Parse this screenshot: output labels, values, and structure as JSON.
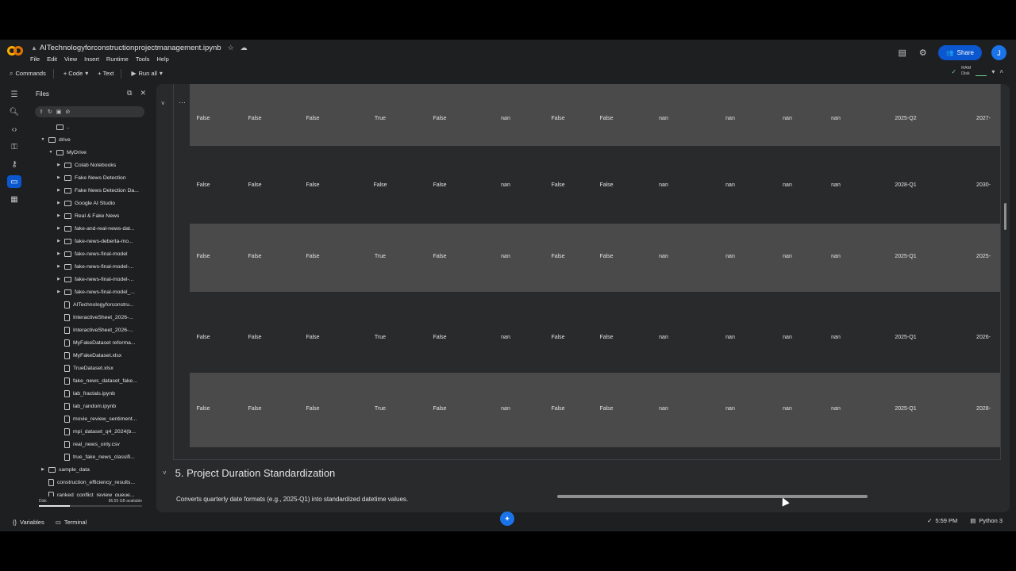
{
  "app": {
    "notebook_title": "AITechnologyforconstructionprojectmanagement.ipynb",
    "menus": [
      "File",
      "Edit",
      "View",
      "Insert",
      "Runtime",
      "Tools",
      "Help"
    ],
    "share_label": "Share",
    "avatar_initial": "J",
    "accent_color": "#0b57d0"
  },
  "toolbar": {
    "commands": "Commands",
    "code": "+ Code",
    "text": "+ Text",
    "run_all": "Run all",
    "ram_label": "RAM",
    "disk_label": "Disk"
  },
  "files_panel": {
    "title": "Files",
    "tree": [
      {
        "label": "..",
        "type": "folder",
        "level": 1,
        "caret": ""
      },
      {
        "label": "drive",
        "type": "folder",
        "level": 0,
        "caret": "▼"
      },
      {
        "label": "MyDrive",
        "type": "folder",
        "level": 1,
        "caret": "▼"
      },
      {
        "label": "Colab Notebooks",
        "type": "folder",
        "level": 2,
        "caret": "▶"
      },
      {
        "label": "Fake News Detection",
        "type": "folder",
        "level": 2,
        "caret": "▶"
      },
      {
        "label": "Fake News Detection Da...",
        "type": "folder",
        "level": 2,
        "caret": "▶"
      },
      {
        "label": "Google AI Studio",
        "type": "folder",
        "level": 2,
        "caret": "▶"
      },
      {
        "label": "Real & Fake News",
        "type": "folder",
        "level": 2,
        "caret": "▶"
      },
      {
        "label": "fake-and-real-news-dat...",
        "type": "folder",
        "level": 2,
        "caret": "▶"
      },
      {
        "label": "fake-news-deberta-mo...",
        "type": "folder",
        "level": 2,
        "caret": "▶"
      },
      {
        "label": "fake-news-final-model",
        "type": "folder",
        "level": 2,
        "caret": "▶"
      },
      {
        "label": "fake-news-final-model-...",
        "type": "folder",
        "level": 2,
        "caret": "▶"
      },
      {
        "label": "fake-news-final-model-...",
        "type": "folder",
        "level": 2,
        "caret": "▶"
      },
      {
        "label": "fake-news-final-model_...",
        "type": "folder",
        "level": 2,
        "caret": "▶"
      },
      {
        "label": "AITechnologyforconstru...",
        "type": "file",
        "level": 2,
        "caret": ""
      },
      {
        "label": "InteractiveSheet_2026-...",
        "type": "file",
        "level": 2,
        "caret": ""
      },
      {
        "label": "InteractiveSheet_2026-...",
        "type": "file",
        "level": 2,
        "caret": ""
      },
      {
        "label": "MyFakeDataset reforma...",
        "type": "file",
        "level": 2,
        "caret": ""
      },
      {
        "label": "MyFakeDataset.xlsx",
        "type": "file",
        "level": 2,
        "caret": ""
      },
      {
        "label": "TrueDataset.xlsx",
        "type": "file",
        "level": 2,
        "caret": ""
      },
      {
        "label": "fake_news_dataset_fake...",
        "type": "table",
        "level": 2,
        "caret": ""
      },
      {
        "label": "lab_fractals.ipynb",
        "type": "file",
        "level": 2,
        "caret": ""
      },
      {
        "label": "lab_random.ipynb",
        "type": "file",
        "level": 2,
        "caret": ""
      },
      {
        "label": "movie_review_sentiment...",
        "type": "file",
        "level": 2,
        "caret": ""
      },
      {
        "label": "mpi_dataset_q4_2024(b...",
        "type": "file",
        "level": 2,
        "caret": ""
      },
      {
        "label": "real_news_only.csv",
        "type": "table",
        "level": 2,
        "caret": ""
      },
      {
        "label": "true_fake_news_classifi...",
        "type": "file",
        "level": 2,
        "caret": ""
      },
      {
        "label": "sample_data",
        "type": "folder",
        "level": 0,
        "caret": "▶"
      },
      {
        "label": "construction_efficiency_results...",
        "type": "table",
        "level": 0,
        "caret": ""
      },
      {
        "label": "ranked_conflict_review_queue...",
        "type": "table",
        "level": 0,
        "caret": ""
      }
    ],
    "disk_label": "Disk",
    "disk_available": "86.55 GB available",
    "disk_used_fraction": 0.3
  },
  "output_table": {
    "rows": [
      {
        "shade": "dark",
        "cells": [
          "False",
          "False",
          "False",
          "True",
          "False",
          "nan",
          "False",
          "False",
          "nan",
          "nan",
          "nan",
          "nan",
          "2025-Q2",
          "2027-"
        ]
      },
      {
        "shade": "light",
        "cells": [
          "False",
          "False",
          "False",
          "False",
          "False",
          "nan",
          "False",
          "False",
          "nan",
          "nan",
          "nan",
          "nan",
          "2028-Q1",
          "2030-"
        ]
      },
      {
        "shade": "dark",
        "cells": [
          "False",
          "False",
          "False",
          "True",
          "False",
          "nan",
          "False",
          "False",
          "nan",
          "nan",
          "nan",
          "nan",
          "2025-Q1",
          "2025-"
        ]
      },
      {
        "shade": "light",
        "cells": [
          "False",
          "False",
          "False",
          "True",
          "False",
          "nan",
          "False",
          "False",
          "nan",
          "nan",
          "nan",
          "nan",
          "2025-Q1",
          "2026-"
        ]
      },
      {
        "shade": "dark",
        "cells": [
          "False",
          "False",
          "False",
          "True",
          "False",
          "nan",
          "False",
          "False",
          "nan",
          "nan",
          "nan",
          "nan",
          "2025-Q1",
          "2028-"
        ]
      }
    ]
  },
  "section": {
    "title": "5. Project Duration Standardization",
    "description": "Converts quarterly date formats (e.g., 2025-Q1) into standardized datetime values."
  },
  "statusbar": {
    "variables": "Variables",
    "terminal": "Terminal",
    "time": "5:59 PM",
    "kernel": "Python 3"
  }
}
